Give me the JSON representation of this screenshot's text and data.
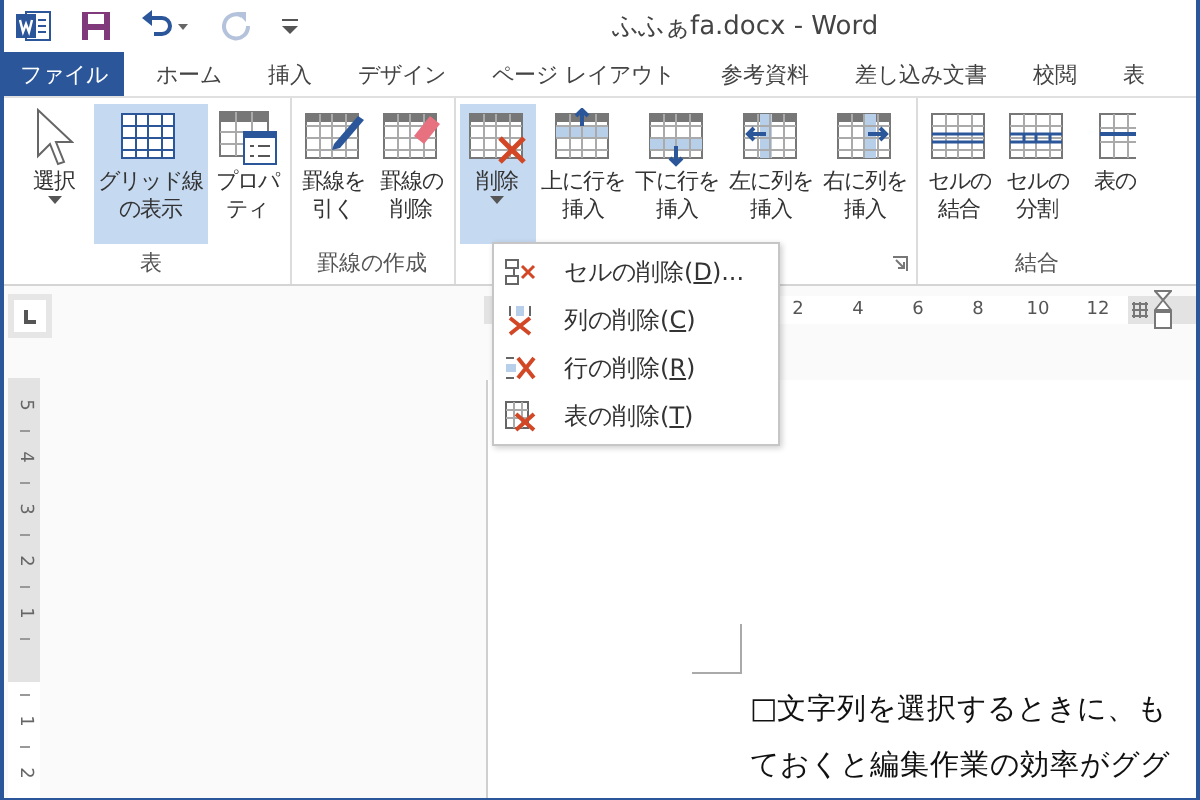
{
  "title_bar": {
    "title": "ふふぁfa.docx - Word",
    "quick_access": [
      {
        "kind": "app"
      },
      {
        "kind": "save",
        "disabled": false
      },
      {
        "kind": "undo",
        "disabled": false
      },
      {
        "kind": "redo",
        "disabled": true
      },
      {
        "kind": "customize"
      }
    ]
  },
  "tabs": [
    {
      "label": "ファイル",
      "selected": true
    },
    {
      "label": "ホーム",
      "selected": false
    },
    {
      "label": "挿入",
      "selected": false
    },
    {
      "label": "デザイン",
      "selected": false
    },
    {
      "label": "ページ レイアウト",
      "selected": false
    },
    {
      "label": "参考資料",
      "selected": false
    },
    {
      "label": "差し込み文書",
      "selected": false
    },
    {
      "label": "校閲",
      "selected": false
    },
    {
      "label": "表",
      "selected": false
    }
  ],
  "ribbon": {
    "groups": [
      {
        "label": "表",
        "launcher": false,
        "buttons": [
          {
            "kind": "select",
            "label": "選択",
            "dropdown": true,
            "selected": false
          },
          {
            "kind": "gridlines",
            "label": "グリッド線の表示",
            "dropdown": false,
            "selected": true
          },
          {
            "kind": "properties",
            "label": "プロパティ",
            "dropdown": false,
            "selected": false
          }
        ]
      },
      {
        "label": "罫線の作成",
        "launcher": false,
        "buttons": [
          {
            "kind": "draw",
            "label": "罫線を引く",
            "dropdown": false,
            "selected": false
          },
          {
            "kind": "erase",
            "label": "罫線の削除",
            "dropdown": false,
            "selected": false
          }
        ]
      },
      {
        "launcher": true,
        "buttons": [
          {
            "kind": "delete",
            "label": "削除",
            "dropdown": true,
            "selected": true
          },
          {
            "kind": "insert-above",
            "label": "上に行を挿入",
            "dropdown": false,
            "selected": false
          },
          {
            "kind": "insert-below",
            "label": "下に行を挿入",
            "dropdown": false,
            "selected": false
          },
          {
            "kind": "insert-left",
            "label": "左に列を挿入",
            "dropdown": false,
            "selected": false
          },
          {
            "kind": "insert-right",
            "label": "右に列を挿入",
            "dropdown": false,
            "selected": false
          }
        ]
      },
      {
        "label": "結合",
        "launcher": false,
        "buttons": [
          {
            "kind": "merge",
            "label": "セルの結合",
            "dropdown": false,
            "selected": false
          },
          {
            "kind": "split",
            "label": "セルの分割",
            "dropdown": false,
            "selected": false
          },
          {
            "kind": "split-table",
            "label": "表の",
            "dropdown": false,
            "selected": false
          }
        ]
      }
    ]
  },
  "dropdown_menu": {
    "items": [
      {
        "kind": "cells",
        "label_start": "セルの削除(",
        "access_key": "D",
        "label_end": ")..."
      },
      {
        "kind": "columns",
        "label_start": "列の削除(",
        "access_key": "C",
        "label_end": ")"
      },
      {
        "kind": "rows",
        "label_start": "行の削除(",
        "access_key": "R",
        "label_end": ")"
      },
      {
        "kind": "table",
        "label_start": "表の削除(",
        "access_key": "T",
        "label_end": ")"
      }
    ]
  },
  "horizontal_ruler": {
    "labels": [
      "2",
      "4",
      "6",
      "8",
      "10",
      "12"
    ]
  },
  "vertical_ruler": {
    "labels_above": [
      "5",
      "4",
      "3",
      "2",
      "1"
    ],
    "labels_below": [
      "1",
      "2"
    ]
  },
  "document": {
    "lines": [
      "□文字列を選択するときに、も",
      "ておくと編集作業の効率がググ"
    ]
  }
}
